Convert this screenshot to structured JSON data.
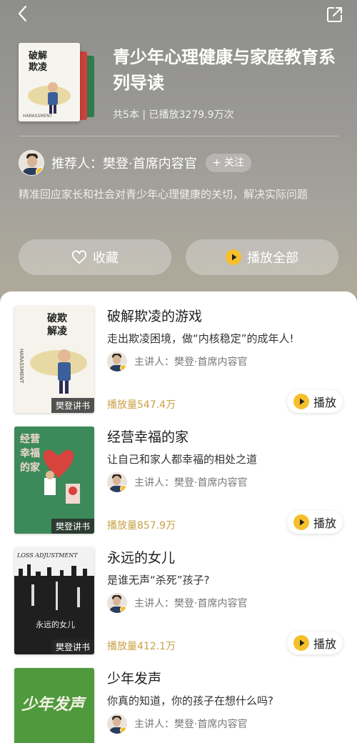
{
  "playlist": {
    "title": "青少年心理健康与家庭教育系列导读",
    "meta": "共5本 | 已播放3279.9万次",
    "cover_text": "破解欺凌的游戏"
  },
  "recommender": {
    "label": "推荐人：樊登·首席内容官",
    "follow_label": "+ 关注"
  },
  "description": "精准回应家长和社会对青少年心理健康的关切，解决实际问题",
  "actions": {
    "favorite_label": "收藏",
    "play_all_label": "播放全部"
  },
  "books": [
    {
      "title": "破解欺凌的游戏",
      "subtitle": "走出欺凌困境，做“内核稳定”的成年人!",
      "speaker": "主讲人：樊登·首席内容官",
      "plays": "播放量547.4万",
      "play_label": "播放",
      "cover_tag": "樊登讲书",
      "cover_text": "破解欺凌的游戏"
    },
    {
      "title": "经营幸福的家",
      "subtitle": "让自己和家人都幸福的相处之道",
      "speaker": "主讲人：樊登·首席内容官",
      "plays": "播放量857.9万",
      "play_label": "播放",
      "cover_tag": "樊登讲书",
      "cover_text": "经营幸福的家"
    },
    {
      "title": "永远的女儿",
      "subtitle": "是谁无声“杀死”孩子?",
      "speaker": "主讲人：樊登·首席内容官",
      "plays": "播放量412.1万",
      "play_label": "播放",
      "cover_tag": "樊登讲书",
      "cover_text": "LOSS ADJUSTMENT",
      "cover_text_cn": "永远的女儿"
    },
    {
      "title": "少年发声",
      "subtitle": "你真的知道，你的孩子在想什么吗?",
      "speaker": "主讲人：樊登·首席内容官",
      "cover_text": "少年发声"
    }
  ]
}
